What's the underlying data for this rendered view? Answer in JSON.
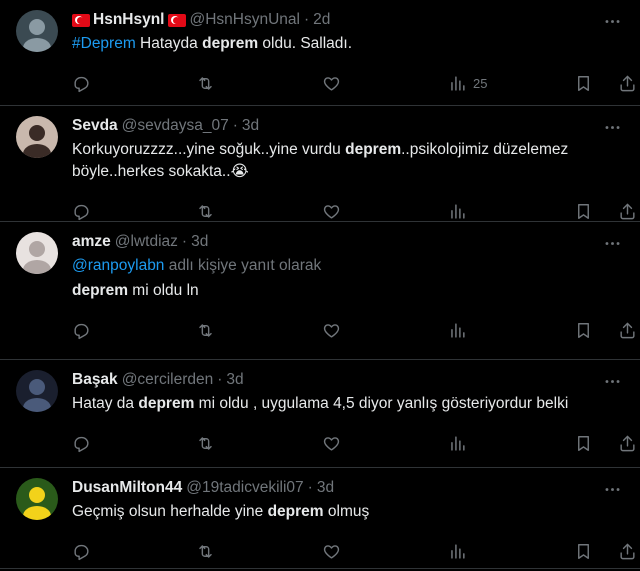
{
  "tweets": [
    {
      "name": "HsnHsynl",
      "handle": "@HsnHsynUnal",
      "time": "2d",
      "flags": true,
      "parts": [
        {
          "t": "#Deprem",
          "style": "hashtag"
        },
        {
          "t": " Hatayda ",
          "style": "plain"
        },
        {
          "t": "deprem",
          "style": "bold"
        },
        {
          "t": " oldu. Salladı.",
          "style": "plain"
        }
      ],
      "views": "25",
      "avatar_colors": [
        "#3b4a52",
        "#8a9aa3"
      ]
    },
    {
      "name": "Sevda",
      "handle": "@sevdaysa_07",
      "time": "3d",
      "parts": [
        {
          "t": "Korkuyoruzzzz...yine soğuk..yine vurdu ",
          "style": "plain"
        },
        {
          "t": "deprem",
          "style": "bold"
        },
        {
          "t": "..psikolojimiz düzelemez böyle..herkes sokakta..😭",
          "style": "plain"
        }
      ],
      "views": "",
      "avatar_colors": [
        "#c9b8ad",
        "#3a2b26"
      ]
    },
    {
      "name": "amze",
      "handle": "@lwtdiaz",
      "time": "3d",
      "replying_mention": "@ranpoylabn",
      "replying_suffix": " adlı kişiye yanıt olarak",
      "parts": [
        {
          "t": "deprem",
          "style": "bold"
        },
        {
          "t": " mi oldu ln",
          "style": "plain"
        }
      ],
      "views": "",
      "avatar_colors": [
        "#e8e2e0",
        "#b0a6a4"
      ]
    },
    {
      "name": "Başak",
      "handle": "@cercilerden",
      "time": "3d",
      "parts": [
        {
          "t": "Hatay da ",
          "style": "plain"
        },
        {
          "t": "deprem",
          "style": "bold"
        },
        {
          "t": " mi oldu , uygulama 4,5 diyor yanlış gösteriyordur belki",
          "style": "plain"
        }
      ],
      "views": "",
      "avatar_colors": [
        "#1a1f2e",
        "#4a5a7a"
      ]
    },
    {
      "name": "DusanMilton44",
      "handle": "@19tadicvekili07",
      "time": "3d",
      "parts": [
        {
          "t": "Geçmiş olsun herhalde yine ",
          "style": "plain"
        },
        {
          "t": "deprem",
          "style": "bold"
        },
        {
          "t": " olmuş",
          "style": "plain"
        }
      ],
      "views": "",
      "avatar_colors": [
        "#2a5a1a",
        "#f2d21a"
      ]
    }
  ],
  "colors": {
    "accent": "#1d9bf0",
    "muted": "#71767b",
    "text": "#e7e9ea",
    "border": "#2f3336",
    "bg": "#000000"
  },
  "icons": {
    "more": "more-horizontal-icon",
    "reply": "reply-icon",
    "retweet": "retweet-icon",
    "like": "heart-icon",
    "views": "views-bar-chart-icon",
    "bookmark": "bookmark-icon",
    "share": "share-icon"
  }
}
